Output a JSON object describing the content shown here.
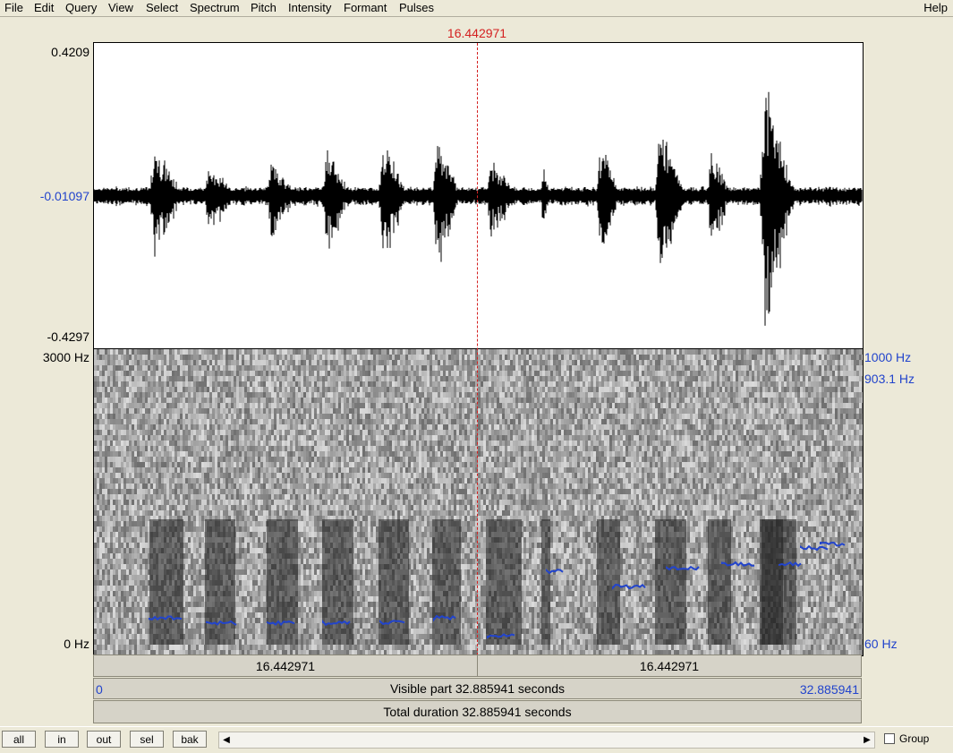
{
  "menu": {
    "items": [
      "File",
      "Edit",
      "Query",
      "View",
      "Select",
      "Spectrum",
      "Pitch",
      "Intensity",
      "Formant",
      "Pulses"
    ],
    "help": "Help"
  },
  "cursor": {
    "time_label": "16.442971"
  },
  "waveform": {
    "y_max": "0.4209",
    "y_mid": "-0.01097",
    "y_min": "-0.4297"
  },
  "spectrogram": {
    "freq_top": "3000 Hz",
    "freq_bottom": "0 Hz"
  },
  "pitch": {
    "top": "1000 Hz",
    "cursor_value": "903.1 Hz",
    "bottom": "60 Hz"
  },
  "time_bars": {
    "left_segment": "16.442971",
    "right_segment": "16.442971",
    "visible_start": "0",
    "visible_label": "Visible part 32.885941 seconds",
    "visible_end": "32.885941",
    "total_label": "Total duration 32.885941 seconds"
  },
  "buttons": {
    "all": "all",
    "in": "in",
    "out": "out",
    "sel": "sel",
    "bak": "bak"
  },
  "group_label": "Group",
  "colors": {
    "cursor": "#d42020",
    "pitch": "#2244cc",
    "axis_blue": "#2244cc"
  }
}
